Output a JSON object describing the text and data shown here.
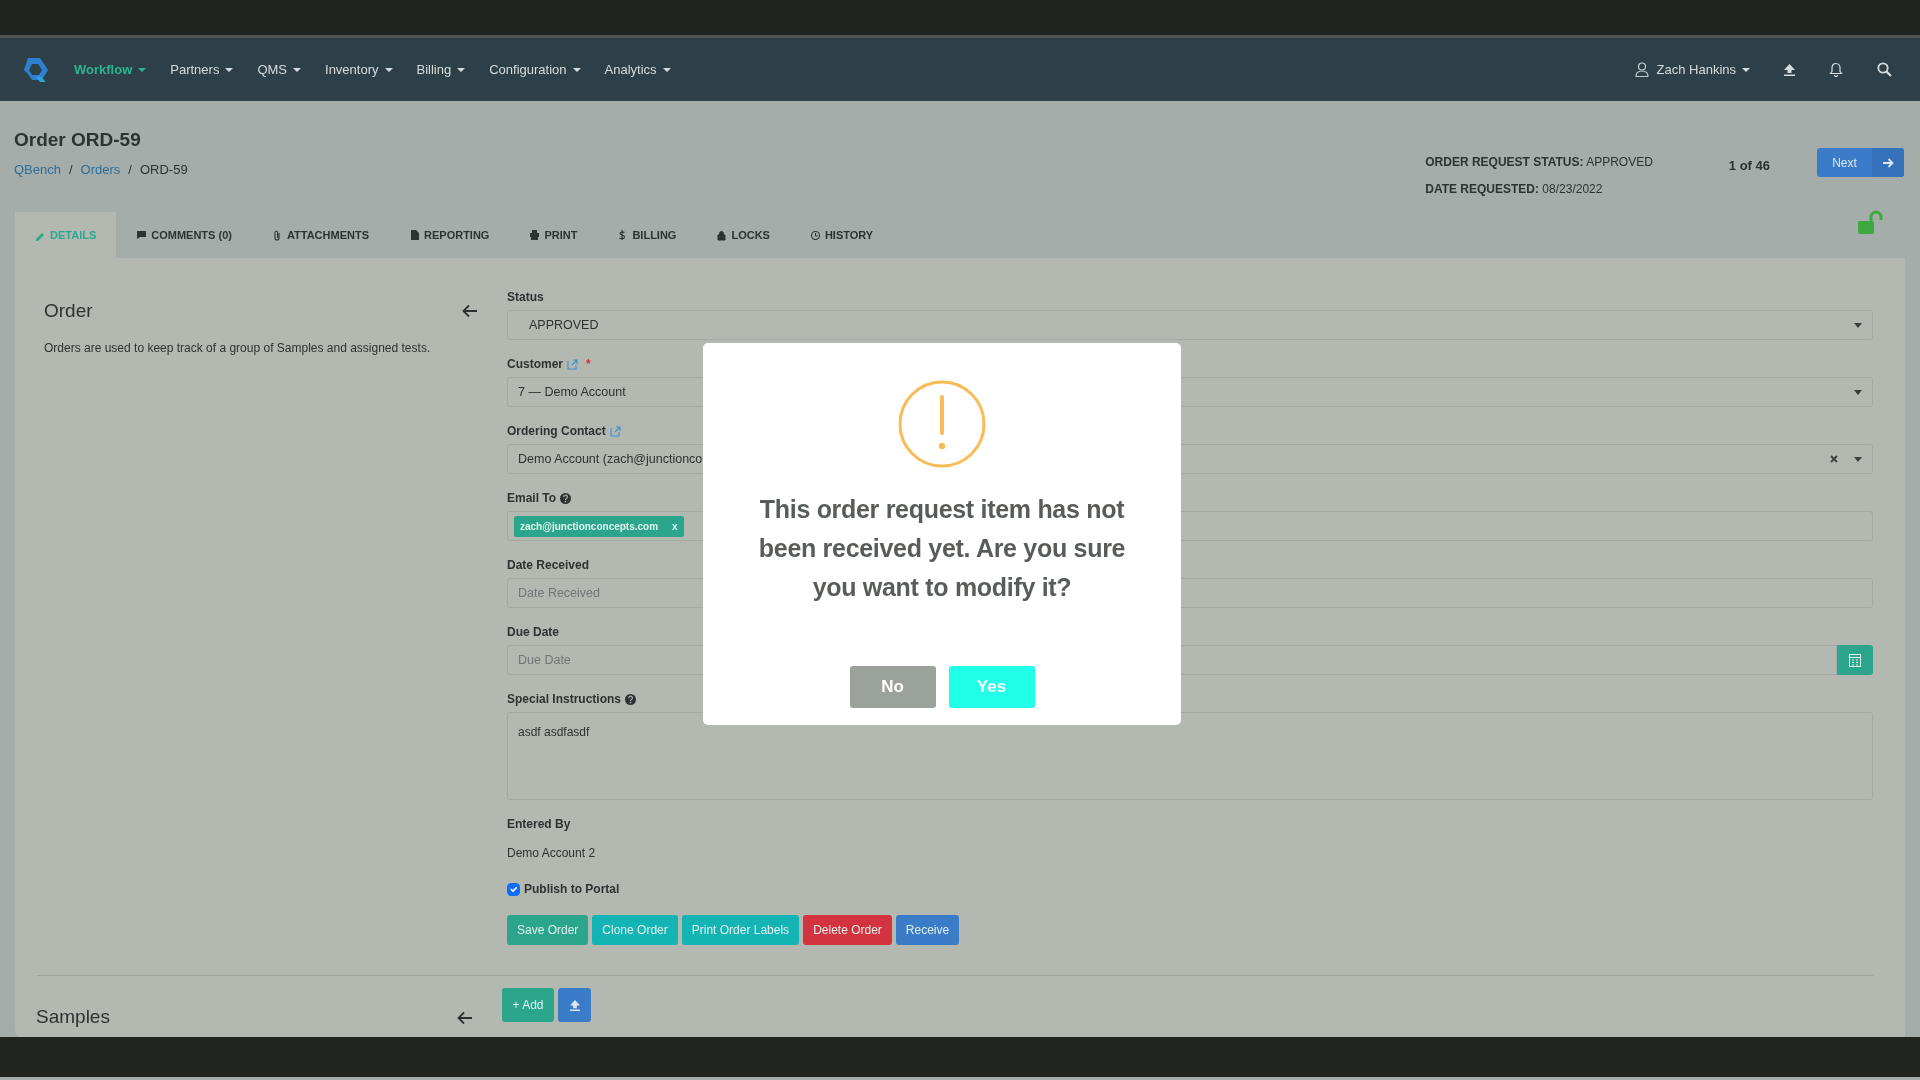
{
  "nav": {
    "items": [
      {
        "label": "Workflow",
        "selected": true
      },
      {
        "label": "Partners",
        "selected": false
      },
      {
        "label": "QMS",
        "selected": false
      },
      {
        "label": "Inventory",
        "selected": false
      },
      {
        "label": "Billing",
        "selected": false
      },
      {
        "label": "Configuration",
        "selected": false
      },
      {
        "label": "Analytics",
        "selected": false
      }
    ],
    "user": "Zach Hankins"
  },
  "header": {
    "title": "Order ORD-59",
    "breadcrumb": [
      {
        "label": "QBench",
        "link": true
      },
      {
        "label": "Orders",
        "link": true
      },
      {
        "label": "ORD-59",
        "link": false
      }
    ],
    "separator": "/",
    "status_label": "ORDER REQUEST STATUS:",
    "status_value": "APPROVED",
    "date_label": "DATE REQUESTED:",
    "date_value": "08/23/2022",
    "pager": "1 of 46",
    "next": "Next",
    "locked": false
  },
  "tabs": [
    {
      "label": "DETAILS",
      "selected": true
    },
    {
      "label": "COMMENTS (0)",
      "selected": false
    },
    {
      "label": "ATTACHMENTS",
      "selected": false
    },
    {
      "label": "REPORTING",
      "selected": false
    },
    {
      "label": "PRINT",
      "selected": false
    },
    {
      "label": "BILLING",
      "selected": false
    },
    {
      "label": "LOCKS",
      "selected": false
    },
    {
      "label": "HISTORY",
      "selected": false
    }
  ],
  "section": {
    "title": "Order",
    "description": "Orders are used to keep track of a group of Samples and assigned tests."
  },
  "fields": [
    {
      "kind": "select",
      "label": "Status",
      "value": "APPROVED"
    },
    {
      "kind": "select",
      "label": "Customer",
      "value": "7 — Demo Account",
      "link": true,
      "required_mark": "*"
    },
    {
      "kind": "select",
      "label": "Ordering Contact",
      "value": "Demo Account (zach@junctionco",
      "link": true,
      "clearable": true
    },
    {
      "kind": "tags",
      "label": "Email To",
      "help": true,
      "tags": [
        {
          "label": "zach@junctionconcepts.com",
          "remove": "x"
        }
      ]
    },
    {
      "kind": "input",
      "label": "Date Received",
      "placeholder": "Date Received"
    },
    {
      "kind": "input",
      "label": "Due Date",
      "placeholder": "Due Date",
      "calendar": true
    },
    {
      "kind": "textarea",
      "label": "Special Instructions",
      "help": true,
      "value": "asdf asdfasdf"
    },
    {
      "kind": "static",
      "label": "Entered By",
      "value": "Demo Account 2"
    }
  ],
  "publish": {
    "label": "Publish to Portal",
    "checked": true
  },
  "actions": [
    {
      "label": "Save Order",
      "color": "#2ba68d"
    },
    {
      "label": "Clone Order",
      "color": "#14b4b4"
    },
    {
      "label": "Print Order Labels",
      "color": "#14b4b4"
    },
    {
      "label": "Delete Order",
      "color": "#d3323f"
    },
    {
      "label": "Receive",
      "color": "#3a7cc8"
    }
  ],
  "samples": {
    "title": "Samples",
    "add": "+ Add"
  },
  "modal": {
    "message": "This order request item has not been received yet. Are you sure you want to modify it?",
    "buttons": [
      {
        "label": "No",
        "kind": "cancel"
      },
      {
        "label": "Yes",
        "kind": "confirm"
      }
    ]
  }
}
